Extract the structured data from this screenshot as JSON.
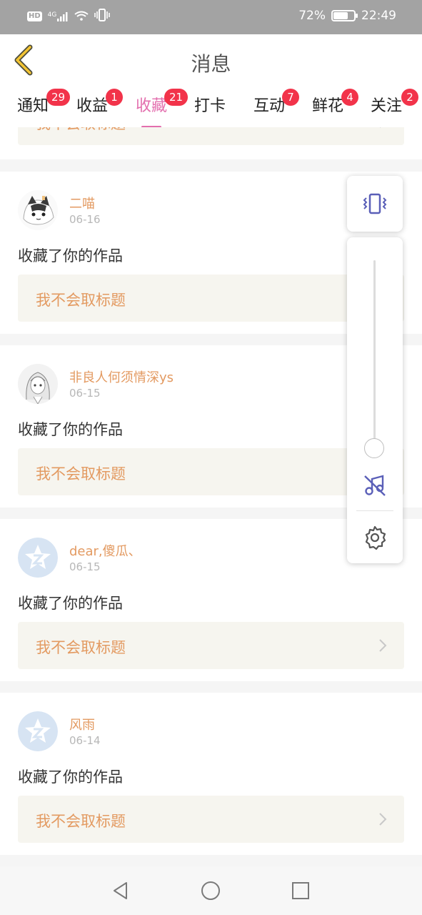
{
  "status_bar": {
    "hd": "HD",
    "network": "4G",
    "battery_text": "72%",
    "battery_level": 0.72,
    "time": "22:49"
  },
  "header": {
    "title": "消息",
    "back_icon": "chevron-left-icon"
  },
  "tabs": [
    {
      "label": "通知",
      "badge": "29",
      "active": false
    },
    {
      "label": "收益",
      "badge": "1",
      "active": false
    },
    {
      "label": "收藏",
      "badge": "21",
      "active": true
    },
    {
      "label": "打卡",
      "badge": "",
      "active": false
    },
    {
      "label": "互动",
      "badge": "7",
      "active": false
    },
    {
      "label": "鲜花",
      "badge": "4",
      "active": false
    },
    {
      "label": "关注",
      "badge": "2",
      "active": false
    }
  ],
  "feed": {
    "partial_work_title": "我不会取标题",
    "items": [
      {
        "name": "二喵",
        "date": "06-16",
        "action": "收藏了你的作品",
        "work_title": "我不会取标题",
        "avatar": "cat-avatar"
      },
      {
        "name": "非良人何须情深ys",
        "date": "06-15",
        "action": "收藏了你的作品",
        "work_title": "我不会取标题",
        "avatar": "anime-girl-avatar"
      },
      {
        "name": "dear,傻瓜、",
        "date": "06-15",
        "action": "收藏了你的作品",
        "work_title": "我不会取标题",
        "avatar": "default-star-avatar"
      },
      {
        "name": "风雨",
        "date": "06-14",
        "action": "收藏了你的作品",
        "work_title": "我不会取标题",
        "avatar": "default-star-avatar"
      }
    ]
  },
  "volume_panel": {
    "vibrate_icon": "vibrate-icon",
    "level": 0,
    "mute_icon": "music-off-icon",
    "settings_icon": "gear-icon"
  },
  "nav_bar": {
    "back_icon": "triangle-back-icon",
    "home_icon": "circle-home-icon",
    "recents_icon": "square-recents-icon"
  },
  "colors": {
    "accent_pink": "#e36fae",
    "name_orange": "#e39a61",
    "badge_red": "#f2334a",
    "card_bg": "#f6f5ef",
    "panel_icon": "#5a5fb8"
  }
}
